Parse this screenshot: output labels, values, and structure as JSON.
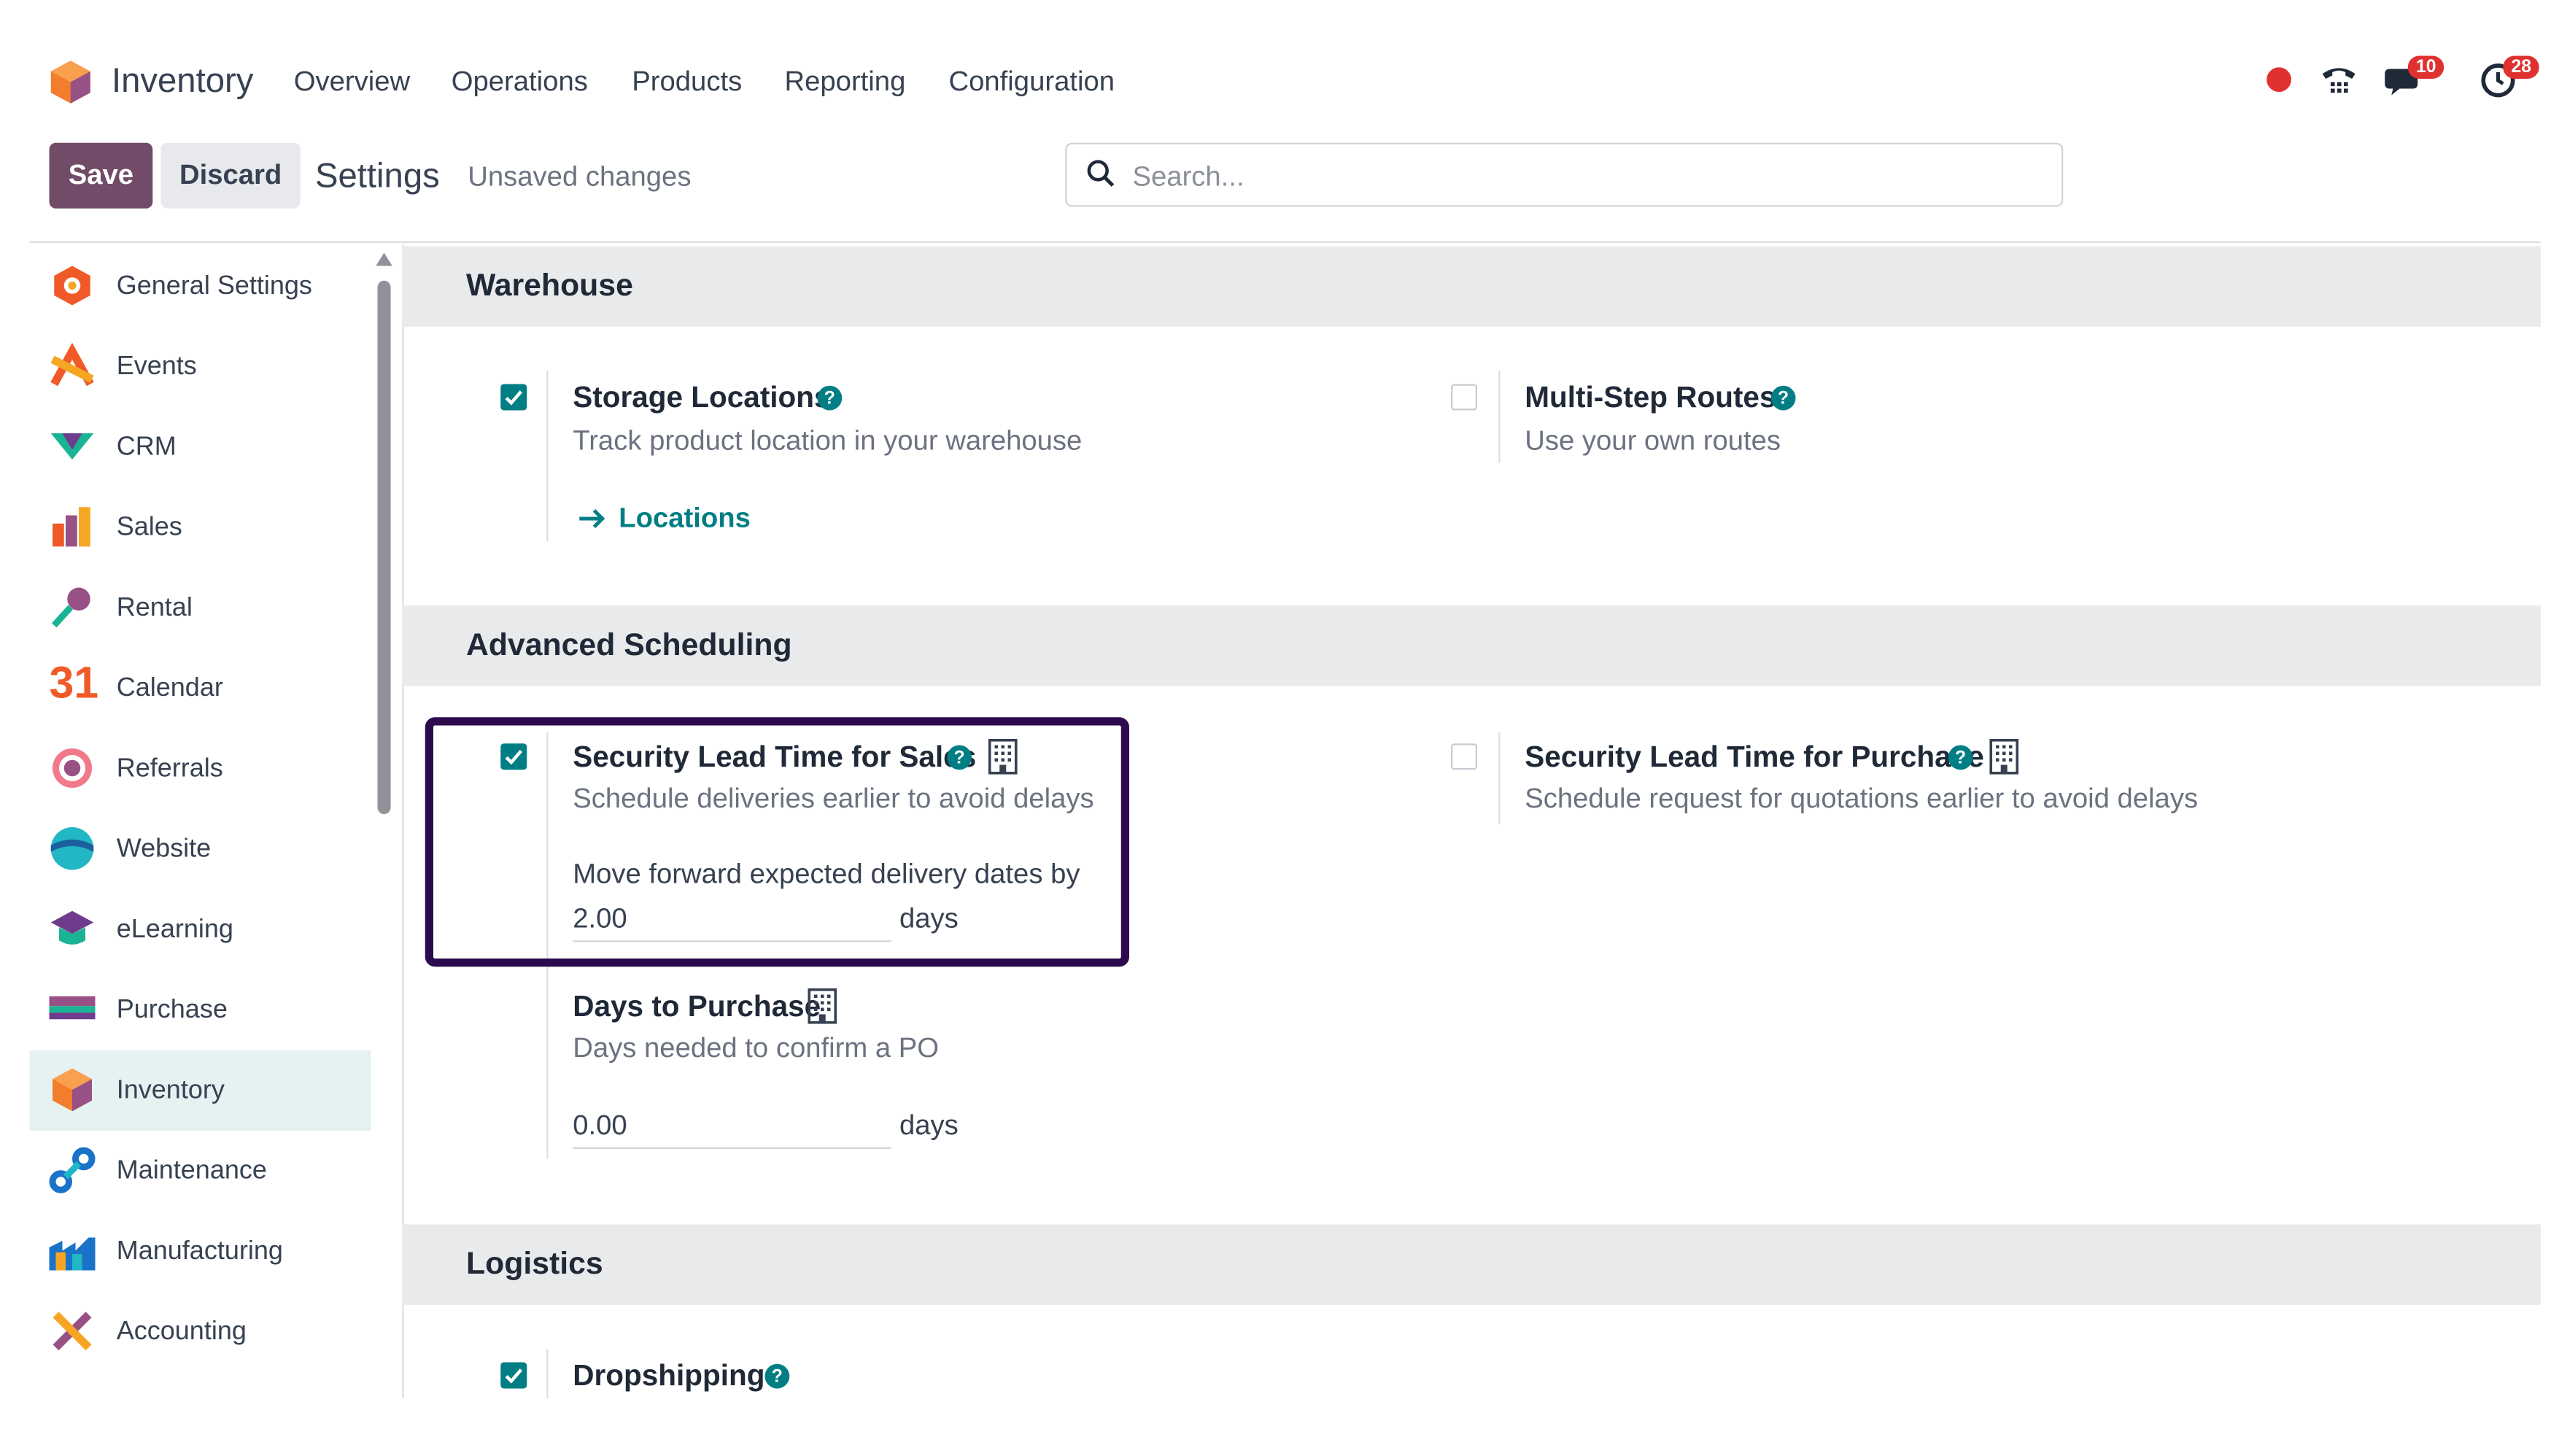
{
  "app": {
    "name": "Inventory"
  },
  "nav": {
    "items": [
      "Overview",
      "Operations",
      "Products",
      "Reporting",
      "Configuration"
    ]
  },
  "system": {
    "messages_badge": "10",
    "activities_badge": "28",
    "record_color": "#e03131"
  },
  "control": {
    "save_label": "Save",
    "discard_label": "Discard",
    "title": "Settings",
    "status": "Unsaved changes",
    "search_placeholder": "Search..."
  },
  "sidebar": {
    "items": [
      {
        "label": "General Settings",
        "icon": "general-settings-icon"
      },
      {
        "label": "Events",
        "icon": "events-icon"
      },
      {
        "label": "CRM",
        "icon": "crm-icon"
      },
      {
        "label": "Sales",
        "icon": "sales-icon"
      },
      {
        "label": "Rental",
        "icon": "rental-icon"
      },
      {
        "label": "Calendar",
        "icon": "calendar-icon"
      },
      {
        "label": "Referrals",
        "icon": "referrals-icon"
      },
      {
        "label": "Website",
        "icon": "website-icon"
      },
      {
        "label": "eLearning",
        "icon": "elearning-icon"
      },
      {
        "label": "Purchase",
        "icon": "purchase-icon"
      },
      {
        "label": "Inventory",
        "icon": "inventory-icon",
        "active": true
      },
      {
        "label": "Maintenance",
        "icon": "maintenance-icon"
      },
      {
        "label": "Manufacturing",
        "icon": "manufacturing-icon"
      },
      {
        "label": "Accounting",
        "icon": "accounting-icon"
      }
    ],
    "calendar_number": "31"
  },
  "sections": {
    "warehouse": {
      "title": "Warehouse",
      "storage_locations": {
        "title": "Storage Locations",
        "desc": "Track product location in your warehouse",
        "checked": true,
        "link": "Locations"
      },
      "multi_step_routes": {
        "title": "Multi-Step Routes",
        "desc": "Use your own routes",
        "checked": false
      }
    },
    "advanced_scheduling": {
      "title": "Advanced Scheduling",
      "lead_time_sales": {
        "title": "Security Lead Time for Sales",
        "desc": "Schedule deliveries earlier to avoid delays",
        "checked": true,
        "field_label": "Move forward expected delivery dates by",
        "value": "2.00",
        "unit": "days"
      },
      "lead_time_purchase": {
        "title": "Security Lead Time for Purchase",
        "desc": "Schedule request for quotations earlier to avoid delays",
        "checked": false
      },
      "days_to_purchase": {
        "title": "Days to Purchase",
        "desc": "Days needed to confirm a PO",
        "value": "0.00",
        "unit": "days"
      }
    },
    "logistics": {
      "title": "Logistics",
      "dropshipping": {
        "title": "Dropshipping",
        "checked": true
      }
    }
  },
  "colors": {
    "accent": "#017e84",
    "primary": "#714b67",
    "highlight_border": "#2b0b4e"
  }
}
